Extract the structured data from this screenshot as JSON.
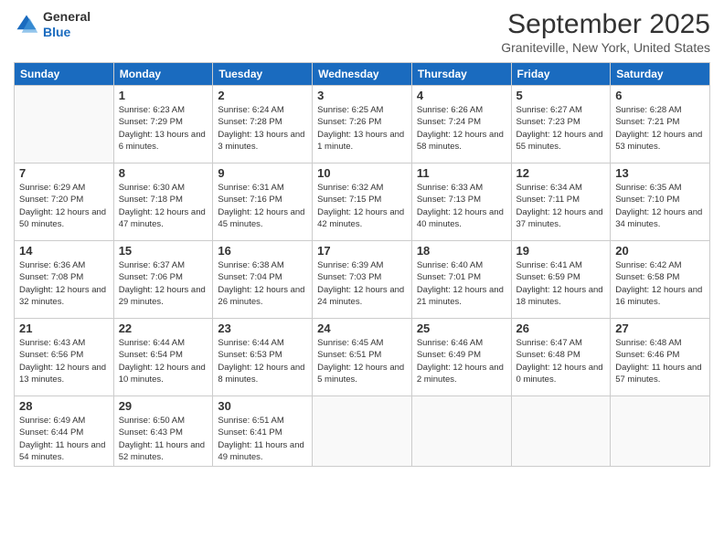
{
  "logo": {
    "general": "General",
    "blue": "Blue"
  },
  "header": {
    "month": "September 2025",
    "location": "Graniteville, New York, United States"
  },
  "weekdays": [
    "Sunday",
    "Monday",
    "Tuesday",
    "Wednesday",
    "Thursday",
    "Friday",
    "Saturday"
  ],
  "weeks": [
    [
      null,
      {
        "day": "1",
        "sunrise": "6:23 AM",
        "sunset": "7:29 PM",
        "daylight": "13 hours and 6 minutes."
      },
      {
        "day": "2",
        "sunrise": "6:24 AM",
        "sunset": "7:28 PM",
        "daylight": "13 hours and 3 minutes."
      },
      {
        "day": "3",
        "sunrise": "6:25 AM",
        "sunset": "7:26 PM",
        "daylight": "13 hours and 1 minute."
      },
      {
        "day": "4",
        "sunrise": "6:26 AM",
        "sunset": "7:24 PM",
        "daylight": "12 hours and 58 minutes."
      },
      {
        "day": "5",
        "sunrise": "6:27 AM",
        "sunset": "7:23 PM",
        "daylight": "12 hours and 55 minutes."
      },
      {
        "day": "6",
        "sunrise": "6:28 AM",
        "sunset": "7:21 PM",
        "daylight": "12 hours and 53 minutes."
      }
    ],
    [
      {
        "day": "7",
        "sunrise": "6:29 AM",
        "sunset": "7:20 PM",
        "daylight": "12 hours and 50 minutes."
      },
      {
        "day": "8",
        "sunrise": "6:30 AM",
        "sunset": "7:18 PM",
        "daylight": "12 hours and 47 minutes."
      },
      {
        "day": "9",
        "sunrise": "6:31 AM",
        "sunset": "7:16 PM",
        "daylight": "12 hours and 45 minutes."
      },
      {
        "day": "10",
        "sunrise": "6:32 AM",
        "sunset": "7:15 PM",
        "daylight": "12 hours and 42 minutes."
      },
      {
        "day": "11",
        "sunrise": "6:33 AM",
        "sunset": "7:13 PM",
        "daylight": "12 hours and 40 minutes."
      },
      {
        "day": "12",
        "sunrise": "6:34 AM",
        "sunset": "7:11 PM",
        "daylight": "12 hours and 37 minutes."
      },
      {
        "day": "13",
        "sunrise": "6:35 AM",
        "sunset": "7:10 PM",
        "daylight": "12 hours and 34 minutes."
      }
    ],
    [
      {
        "day": "14",
        "sunrise": "6:36 AM",
        "sunset": "7:08 PM",
        "daylight": "12 hours and 32 minutes."
      },
      {
        "day": "15",
        "sunrise": "6:37 AM",
        "sunset": "7:06 PM",
        "daylight": "12 hours and 29 minutes."
      },
      {
        "day": "16",
        "sunrise": "6:38 AM",
        "sunset": "7:04 PM",
        "daylight": "12 hours and 26 minutes."
      },
      {
        "day": "17",
        "sunrise": "6:39 AM",
        "sunset": "7:03 PM",
        "daylight": "12 hours and 24 minutes."
      },
      {
        "day": "18",
        "sunrise": "6:40 AM",
        "sunset": "7:01 PM",
        "daylight": "12 hours and 21 minutes."
      },
      {
        "day": "19",
        "sunrise": "6:41 AM",
        "sunset": "6:59 PM",
        "daylight": "12 hours and 18 minutes."
      },
      {
        "day": "20",
        "sunrise": "6:42 AM",
        "sunset": "6:58 PM",
        "daylight": "12 hours and 16 minutes."
      }
    ],
    [
      {
        "day": "21",
        "sunrise": "6:43 AM",
        "sunset": "6:56 PM",
        "daylight": "12 hours and 13 minutes."
      },
      {
        "day": "22",
        "sunrise": "6:44 AM",
        "sunset": "6:54 PM",
        "daylight": "12 hours and 10 minutes."
      },
      {
        "day": "23",
        "sunrise": "6:44 AM",
        "sunset": "6:53 PM",
        "daylight": "12 hours and 8 minutes."
      },
      {
        "day": "24",
        "sunrise": "6:45 AM",
        "sunset": "6:51 PM",
        "daylight": "12 hours and 5 minutes."
      },
      {
        "day": "25",
        "sunrise": "6:46 AM",
        "sunset": "6:49 PM",
        "daylight": "12 hours and 2 minutes."
      },
      {
        "day": "26",
        "sunrise": "6:47 AM",
        "sunset": "6:48 PM",
        "daylight": "12 hours and 0 minutes."
      },
      {
        "day": "27",
        "sunrise": "6:48 AM",
        "sunset": "6:46 PM",
        "daylight": "11 hours and 57 minutes."
      }
    ],
    [
      {
        "day": "28",
        "sunrise": "6:49 AM",
        "sunset": "6:44 PM",
        "daylight": "11 hours and 54 minutes."
      },
      {
        "day": "29",
        "sunrise": "6:50 AM",
        "sunset": "6:43 PM",
        "daylight": "11 hours and 52 minutes."
      },
      {
        "day": "30",
        "sunrise": "6:51 AM",
        "sunset": "6:41 PM",
        "daylight": "11 hours and 49 minutes."
      },
      null,
      null,
      null,
      null
    ]
  ]
}
